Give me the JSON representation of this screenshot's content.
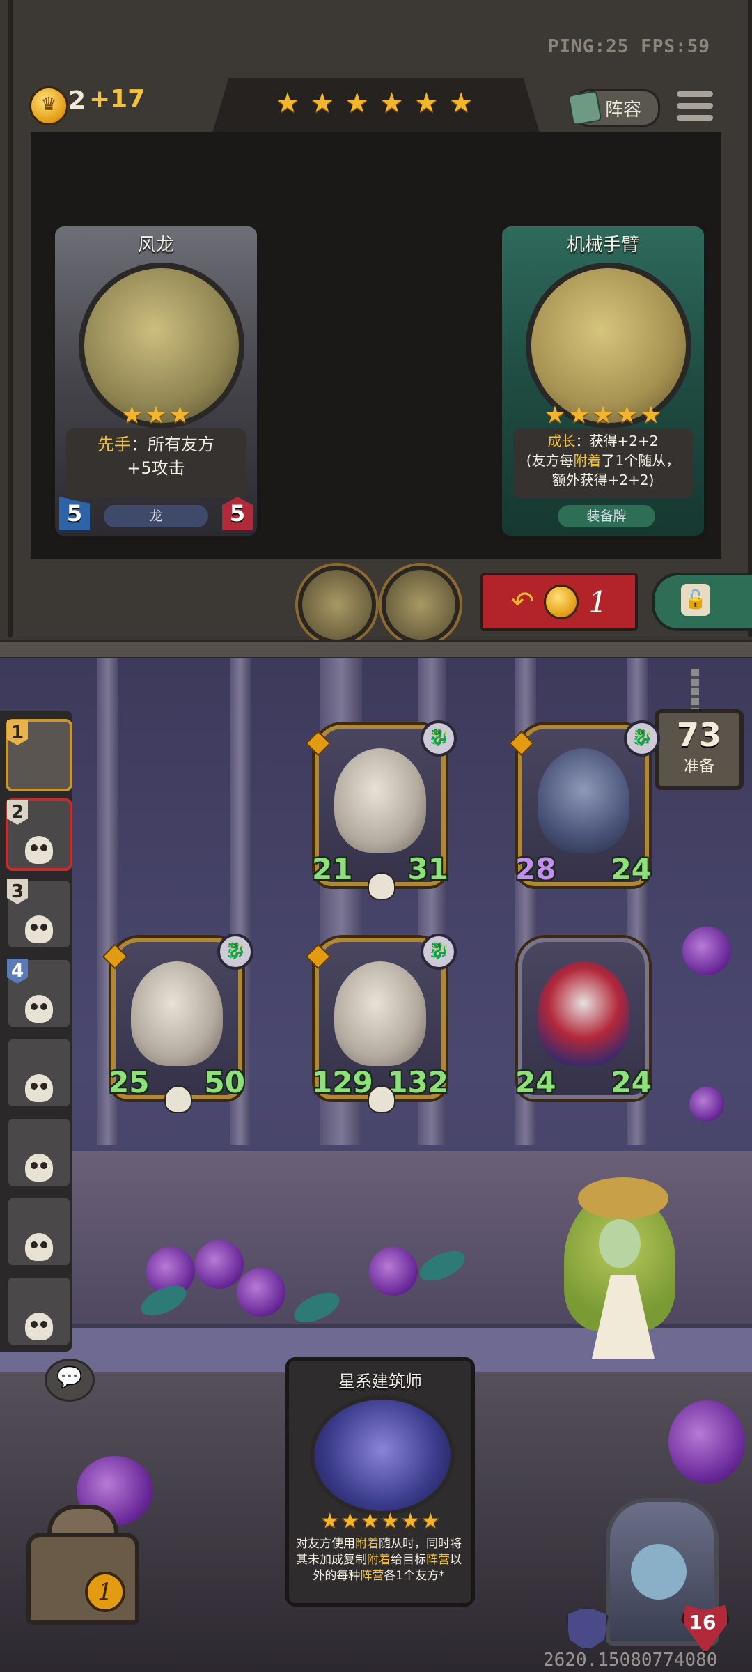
{
  "status": {
    "ping_fps": "PING:25   FPS:59"
  },
  "player": {
    "gold": "2",
    "gold_income": "+17"
  },
  "shop": {
    "tier_stars": 6,
    "lineup_label": "阵容",
    "cards": [
      {
        "name": "风龙",
        "stars": 3,
        "text_kw": "先手",
        "text_rest": "：所有友方",
        "text_line2": "+5攻击",
        "tag": "龙",
        "attack": "5",
        "health": "5"
      },
      {
        "name": "机械手臂",
        "stars": 5,
        "text_kw": "成长",
        "text_rest": "：获得+2+2",
        "text_line2a": "(友方每",
        "text_kw2": "附着",
        "text_line2b": "了1个随从，",
        "text_line3": "额外获得+2+2)",
        "tag": "装备牌"
      }
    ],
    "refresh_cost": "1"
  },
  "battle": {
    "ready_count": "73",
    "ready_label": "准备",
    "team_slots": [
      "1",
      "2",
      "3",
      "4"
    ],
    "minions": [
      {
        "attack": "21",
        "health": "31"
      },
      {
        "attack": "28",
        "health": "24"
      },
      {
        "attack": "25",
        "health": "50"
      },
      {
        "attack": "129",
        "health": "132"
      },
      {
        "attack": "24",
        "health": "24"
      }
    ]
  },
  "hand_card": {
    "name": "星系建筑师",
    "stars": 6,
    "text_a": "对友方使用",
    "text_kw1": "附着",
    "text_b": "随从时，同时将其未加成复制",
    "text_kw2": "附着",
    "text_c": "给目标",
    "text_kw3": "阵营",
    "text_d": "以外的每种",
    "text_kw4": "阵营",
    "text_e": "各1个友方*"
  },
  "hero": {
    "health": "16",
    "chest_count": "1"
  },
  "footer": {
    "build": "2620.15080774080"
  }
}
